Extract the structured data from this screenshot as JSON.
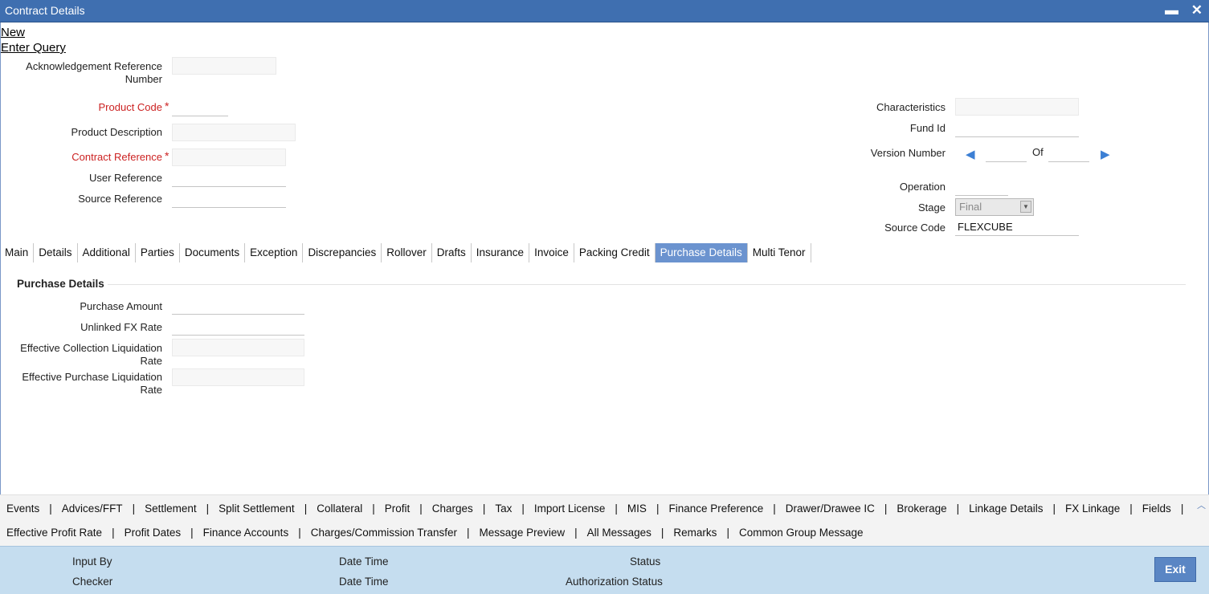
{
  "window": {
    "title": "Contract Details",
    "minimize": "▬",
    "close": "✕"
  },
  "menu": {
    "new": "New",
    "enter_query": "Enter Query"
  },
  "header_left": {
    "ack_ref_label": "Acknowledgement Reference Number",
    "product_code_label": "Product Code",
    "product_desc_label": "Product Description",
    "contract_ref_label": "Contract Reference",
    "user_ref_label": "User Reference",
    "source_ref_label": "Source Reference",
    "required_mark": "*"
  },
  "header_right": {
    "characteristics_label": "Characteristics",
    "fund_id_label": "Fund Id",
    "version_label": "Version Number",
    "of_label": "Of",
    "operation_label": "Operation",
    "stage_label": "Stage",
    "stage_value": "Final",
    "source_code_label": "Source Code",
    "source_code_value": "FLEXCUBE"
  },
  "tabs": [
    "Main",
    "Details",
    "Additional",
    "Parties",
    "Documents",
    "Exception",
    "Discrepancies",
    "Rollover",
    "Drafts",
    "Insurance",
    "Invoice",
    "Packing Credit",
    "Purchase Details",
    "Multi Tenor"
  ],
  "active_tab": "Purchase Details",
  "purchase": {
    "section_title": "Purchase Details",
    "amount_label": "Purchase Amount",
    "unlinked_fx_label": "Unlinked FX Rate",
    "eff_coll_label": "Effective Collection Liquidation Rate",
    "eff_purch_label": "Effective Purchase Liquidation Rate"
  },
  "bottom_links": {
    "row1": [
      "Events",
      "Advices/FFT",
      "Settlement",
      "Split Settlement",
      "Collateral",
      "Profit",
      "Charges",
      "Tax",
      "Import License",
      "MIS",
      "Finance Preference",
      "Drawer/Drawee IC",
      "Brokerage",
      "Linkage Details",
      "FX Linkage",
      "Fields"
    ],
    "row2": [
      "Effective Profit Rate",
      "Profit Dates",
      "Finance Accounts",
      "Charges/Commission Transfer",
      "Message Preview",
      "All Messages",
      "Remarks",
      "Common Group Message"
    ]
  },
  "footer": {
    "input_by": "Input By",
    "checker": "Checker",
    "date_time": "Date Time",
    "status": "Status",
    "auth_status": "Authorization Status",
    "exit": "Exit"
  }
}
